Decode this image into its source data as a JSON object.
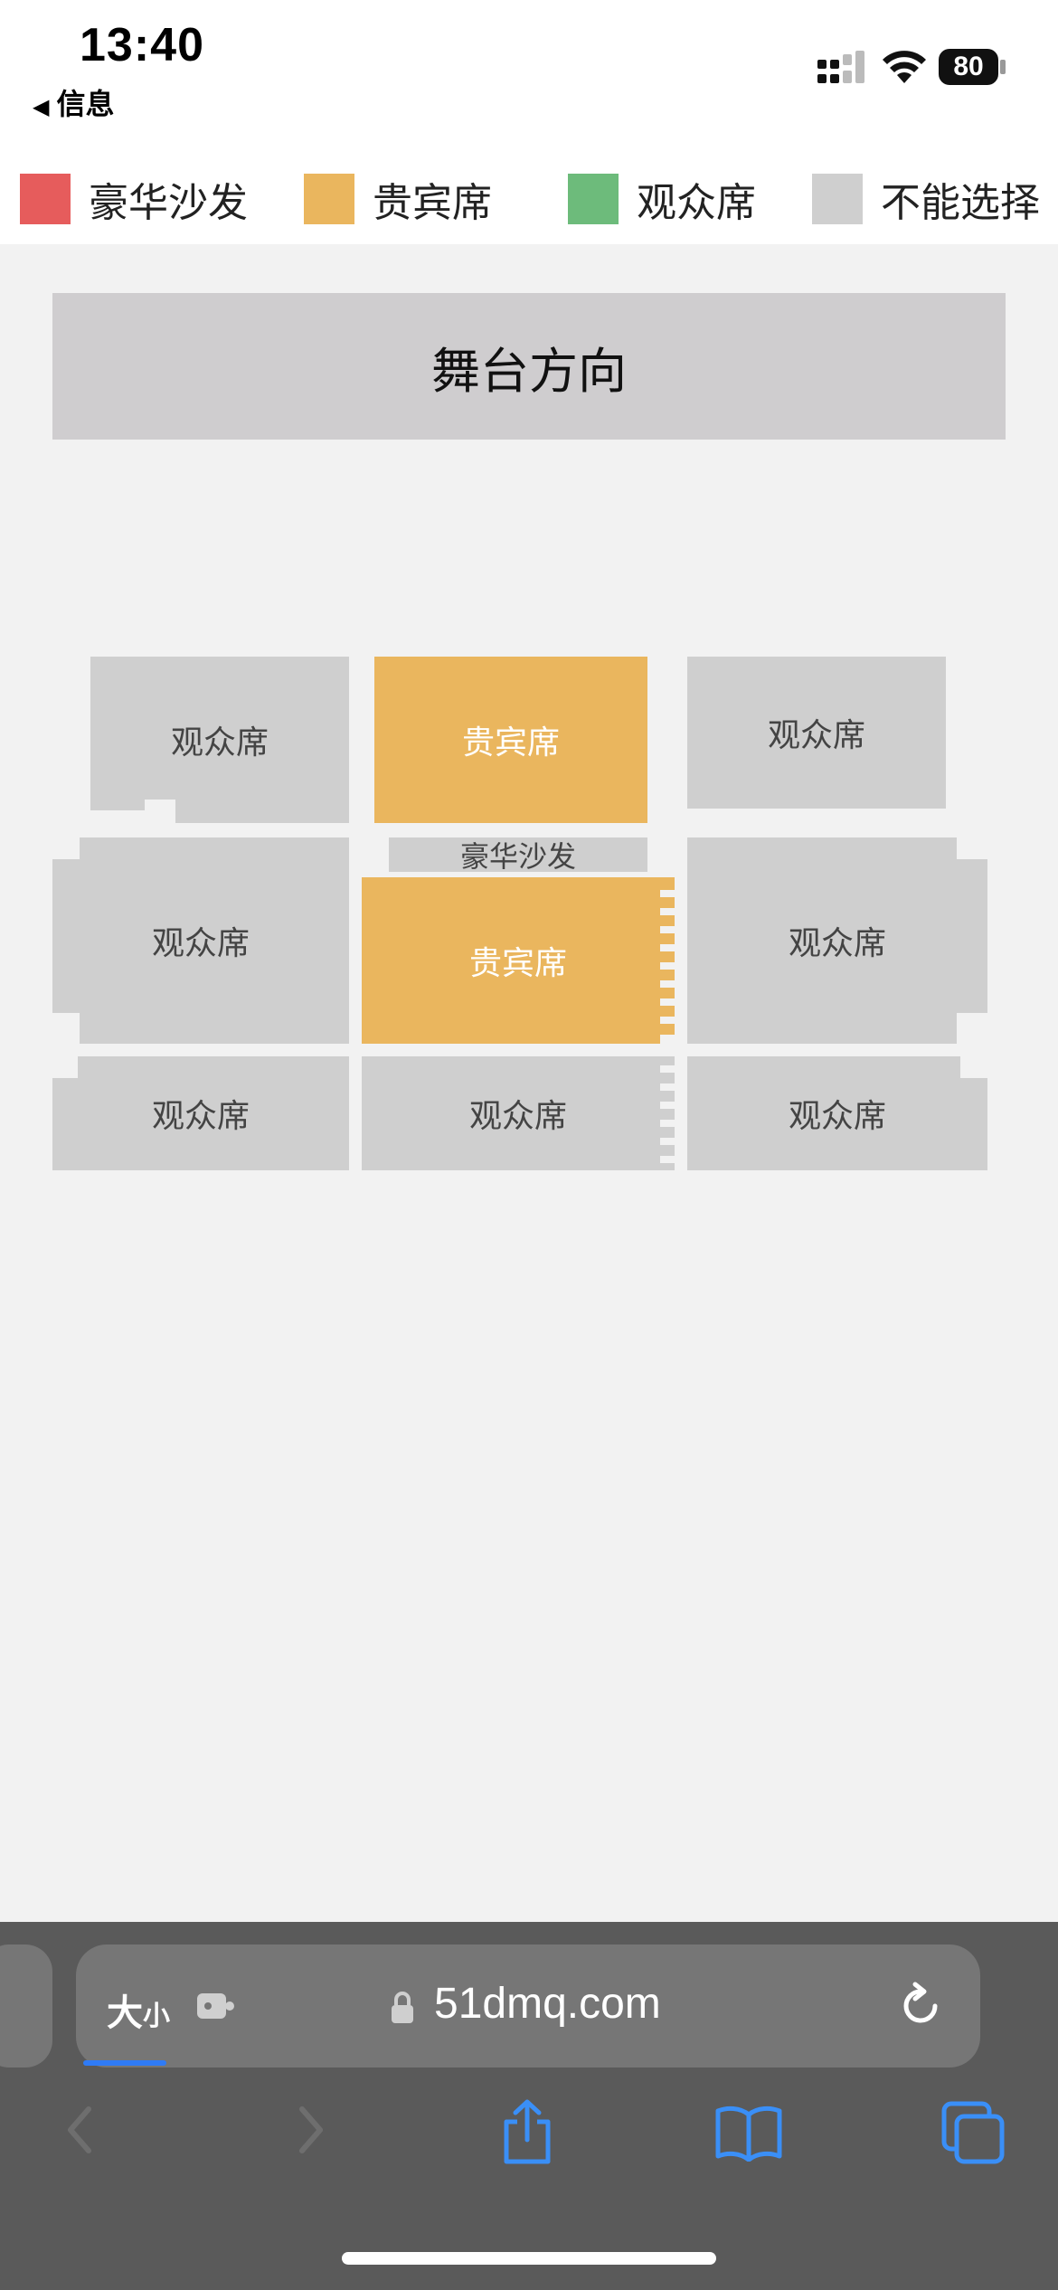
{
  "status_bar": {
    "time": "13:40",
    "back_label": "信息",
    "battery": "80"
  },
  "legend": [
    {
      "label": "豪华沙发",
      "color": "#e65c5c"
    },
    {
      "label": "贵宾席",
      "color": "#eab65e"
    },
    {
      "label": "观众席",
      "color": "#6dbb7b"
    },
    {
      "label": "不能选择",
      "color": "#cfcfcf"
    }
  ],
  "stage": {
    "label": "舞台方向"
  },
  "sections": {
    "top_left": "观众席",
    "top_center": "贵宾席",
    "top_right": "观众席",
    "luxury_sofa": "豪华沙发",
    "mid_left": "观众席",
    "mid_center": "贵宾席",
    "mid_right": "观众席",
    "bottom_left": "观众席",
    "bottom_center": "观众席",
    "bottom_right": "观众席"
  },
  "browser": {
    "text_size_label": "大",
    "text_size_small": "小",
    "url": "51dmq.com"
  },
  "colors": {
    "vip": "#eab65e",
    "audience": "#cfcfcf",
    "background": "#f2f2f2",
    "accent": "#2f7bf6"
  }
}
